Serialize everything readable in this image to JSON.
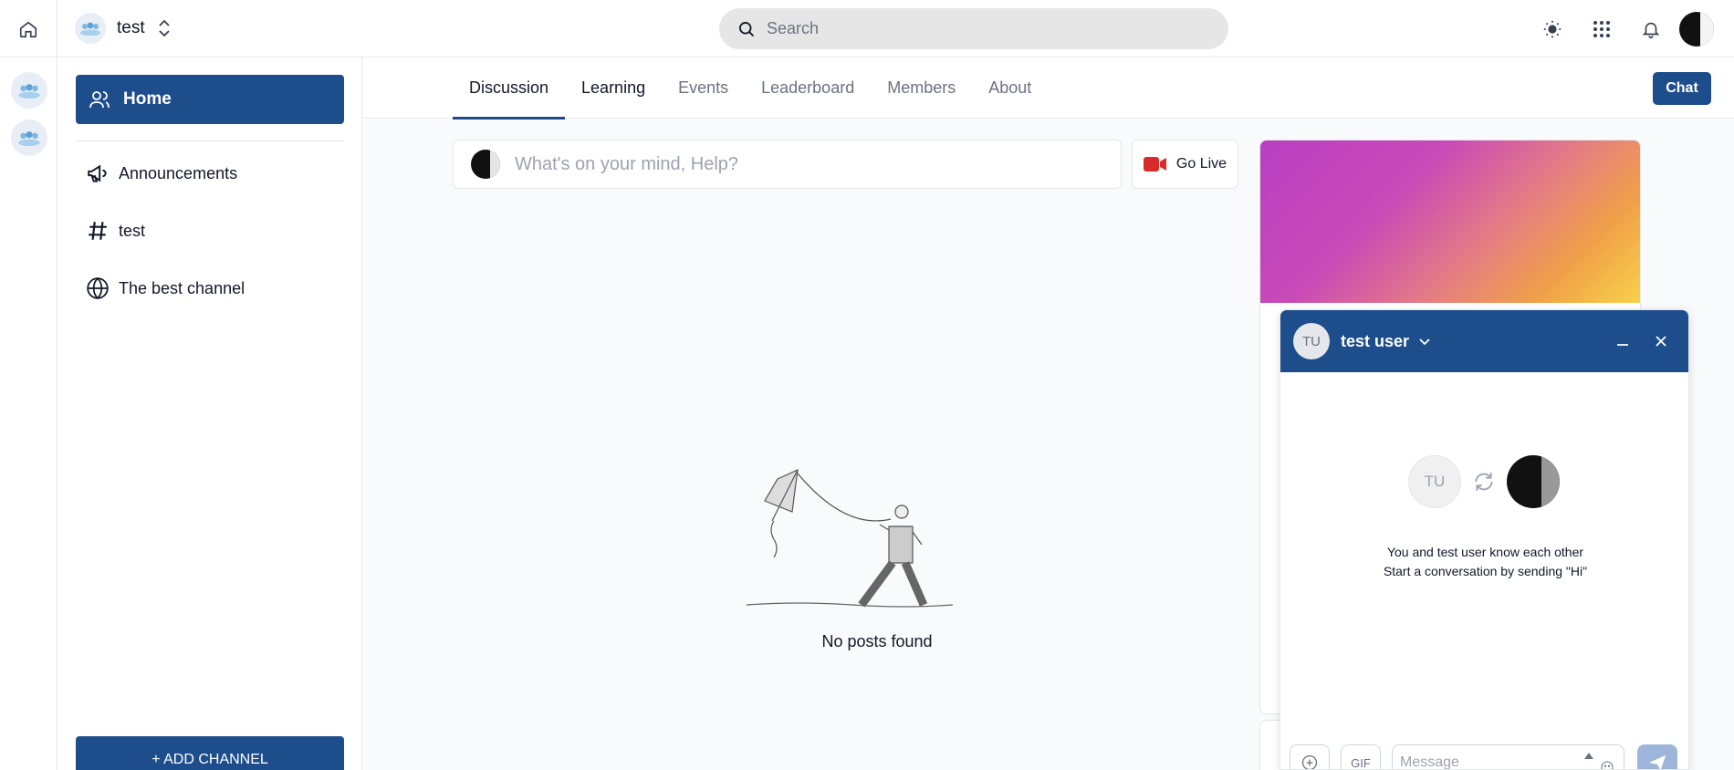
{
  "topbar": {
    "community_name": "test",
    "search_placeholder": "Search"
  },
  "sidebar": {
    "home_label": "Home",
    "channels": [
      {
        "label": "Announcements",
        "icon": "megaphone-icon"
      },
      {
        "label": "test",
        "icon": "hash-icon"
      },
      {
        "label": "The best channel",
        "icon": "globe-icon"
      }
    ],
    "add_channel_label": "+ ADD CHANNEL"
  },
  "tabs": [
    {
      "label": "Discussion",
      "active": true
    },
    {
      "label": "Learning",
      "active": false
    },
    {
      "label": "Events",
      "active": false
    },
    {
      "label": "Leaderboard",
      "active": false
    },
    {
      "label": "Members",
      "active": false
    },
    {
      "label": "About",
      "active": false
    }
  ],
  "chat_button_label": "Chat",
  "composer": {
    "placeholder": "What's on your mind, Help?",
    "go_live_label": "Go Live"
  },
  "empty_state": {
    "label": "No posts found"
  },
  "chat_window": {
    "user_initials": "TU",
    "user_name": "test user",
    "info_line1": "You and test user know each other",
    "info_line2": "Start a conversation by sending \"Hi\"",
    "gif_label": "GIF",
    "message_placeholder": "Message"
  },
  "colors": {
    "primary": "#1e4d8c",
    "live_red": "#d92b2b"
  }
}
